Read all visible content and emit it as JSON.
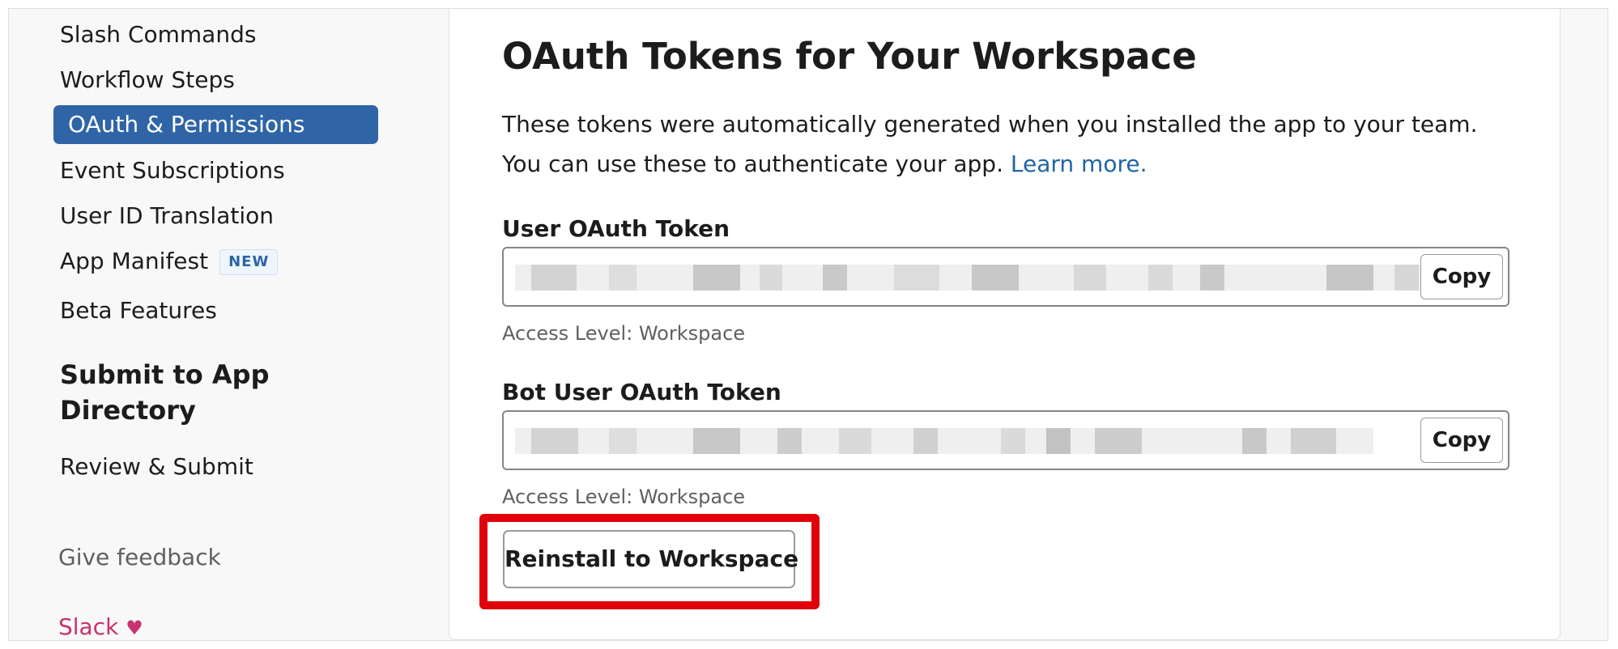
{
  "sidebar": {
    "items": [
      {
        "label": "Slash Commands"
      },
      {
        "label": "Workflow Steps"
      },
      {
        "label": "OAuth & Permissions"
      },
      {
        "label": "Event Subscriptions"
      },
      {
        "label": "User ID Translation"
      },
      {
        "label": "App Manifest",
        "badge": "NEW"
      },
      {
        "label": "Beta Features"
      }
    ],
    "section_heading": "Submit to App Directory",
    "review_label": "Review & Submit",
    "feedback_label": "Give feedback",
    "footer_brand": "Slack",
    "footer_heart": "♥"
  },
  "main": {
    "title": "OAuth Tokens for Your Workspace",
    "description": "These tokens were automatically generated when you installed the app to your team. You can use these to authenticate your app.",
    "learn_more": "Learn more.",
    "user_token": {
      "label": "User OAuth Token",
      "copy_label": "Copy",
      "access_level": "Access Level: Workspace"
    },
    "bot_token": {
      "label": "Bot User OAuth Token",
      "copy_label": "Copy",
      "access_level": "Access Level: Workspace"
    },
    "reinstall_label": "Reinstall to Workspace"
  },
  "colors": {
    "active_nav": "#2f65a6",
    "link": "#1f64a5",
    "highlight": "#e0000b",
    "brand_pink": "#c9326f"
  }
}
